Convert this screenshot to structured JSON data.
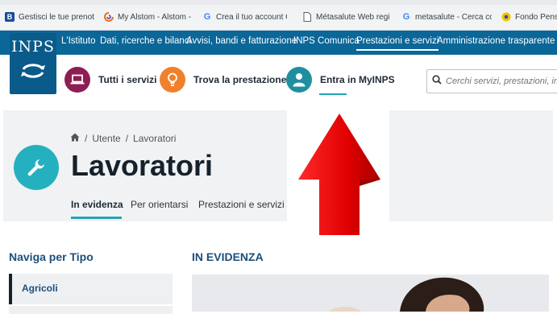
{
  "bookmarks": [
    {
      "label": "Gestisci le tue prenot",
      "icon": "b-letter-icon",
      "color": "#1a4b9c"
    },
    {
      "label": "My Alstom - Alstom -",
      "icon": "alstom-swirl-icon",
      "color": "#e8711a"
    },
    {
      "label": "Crea il tuo account G",
      "icon": "google-g-icon",
      "color": "#4285f4"
    },
    {
      "label": "Métasalute Web regi",
      "icon": "document-icon",
      "color": "#5f6368"
    },
    {
      "label": "metasalute - Cerca co",
      "icon": "google-g-icon",
      "color": "#4285f4"
    },
    {
      "label": "Fondo Pens",
      "icon": "yellow-dot-icon",
      "color": "#f2c200"
    }
  ],
  "header": {
    "logo_text": "INPS",
    "nav": [
      {
        "label": "L'Istituto",
        "active": false
      },
      {
        "label": "Dati, ricerche e bilanci",
        "active": false
      },
      {
        "label": "Avvisi, bandi e fatturazione",
        "active": false
      },
      {
        "label": "INPS Comunica",
        "active": false
      },
      {
        "label": "Prestazioni e servizi",
        "active": true
      },
      {
        "label": "Amministrazione trasparente",
        "active": false
      }
    ]
  },
  "subnav": {
    "tutti_servizi": "Tutti i servizi",
    "trova_prestazione": "Trova la prestazione",
    "myinps": "Entra in MyINPS",
    "search_placeholder": "Cerchi servizi, prestazioni, inf"
  },
  "hero": {
    "breadcrumb": [
      "Utente",
      "Lavoratori"
    ],
    "breadcrumb_sep": "/",
    "title": "Lavoratori",
    "tabs": [
      {
        "label": "In evidenza",
        "active": true
      },
      {
        "label": "Per orientarsi",
        "active": false
      },
      {
        "label": "Prestazioni e servizi",
        "active": false
      }
    ]
  },
  "sidebar": {
    "title": "Naviga per Tipo",
    "items": [
      {
        "label": "Agricoli"
      }
    ]
  },
  "main": {
    "title": "IN EVIDENZA"
  },
  "colors": {
    "inps_blue": "#0b6798",
    "teal": "#25b0c0",
    "tutti_circle": "#8e1d54",
    "trova_circle": "#f0812c",
    "arrow_red": "#e10000"
  }
}
